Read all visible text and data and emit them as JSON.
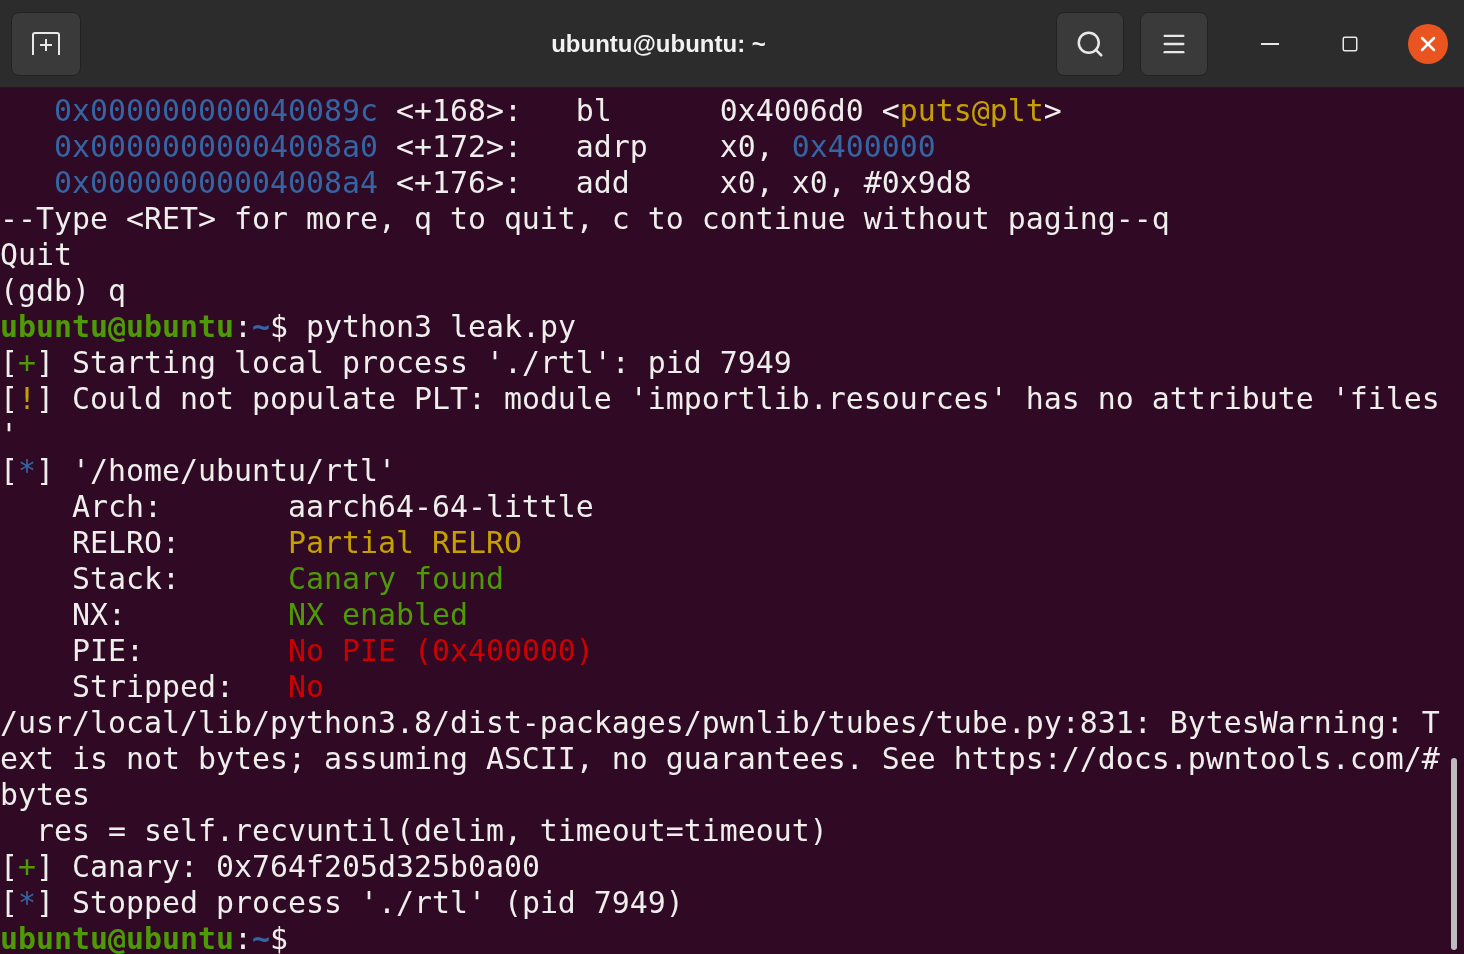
{
  "window": {
    "title": "ubuntu@ubuntu: ~"
  },
  "terminal": {
    "lines": [
      {
        "kind": "output",
        "segments": [
          {
            "text": "   0x000000000040089c",
            "color": "#3465a4"
          },
          {
            "text": " <+168>:   bl      0x4006d0 <",
            "color": "#eeeeec"
          },
          {
            "text": "puts@plt",
            "color": "#c4a000"
          },
          {
            "text": ">",
            "color": "#eeeeec"
          }
        ]
      },
      {
        "kind": "output",
        "segments": [
          {
            "text": "   0x00000000004008a0",
            "color": "#3465a4"
          },
          {
            "text": " <+172>:   adrp    x0, ",
            "color": "#eeeeec"
          },
          {
            "text": "0x400000",
            "color": "#3465a4"
          }
        ]
      },
      {
        "kind": "output",
        "segments": [
          {
            "text": "   0x00000000004008a4",
            "color": "#3465a4"
          },
          {
            "text": " <+176>:   add     x0, x0, #0x9d8",
            "color": "#eeeeec"
          }
        ]
      },
      {
        "kind": "output",
        "segments": [
          {
            "text": "--Type <RET> for more, q to quit, c to continue without paging--q",
            "color": "#eeeeec"
          }
        ]
      },
      {
        "kind": "output",
        "segments": [
          {
            "text": "Quit",
            "color": "#eeeeec"
          }
        ]
      },
      {
        "kind": "output",
        "segments": [
          {
            "text": "(gdb) q",
            "color": "#eeeeec"
          }
        ]
      },
      {
        "kind": "prompt",
        "user": "ubuntu@ubuntu",
        "separator": ":",
        "path": "~",
        "symbol": "$",
        "command": "python3 leak.py"
      },
      {
        "kind": "output",
        "segments": [
          {
            "text": "[",
            "color": "#eeeeec"
          },
          {
            "text": "+",
            "color": "#4e9a06"
          },
          {
            "text": "] Starting local process './rtl': pid 7949",
            "color": "#eeeeec"
          }
        ]
      },
      {
        "kind": "output",
        "segments": [
          {
            "text": "[",
            "color": "#eeeeec"
          },
          {
            "text": "!",
            "color": "#c4a000"
          },
          {
            "text": "] Could not populate PLT: module 'importlib.resources' has no attribute 'files",
            "color": "#eeeeec"
          }
        ]
      },
      {
        "kind": "output",
        "segments": [
          {
            "text": "'",
            "color": "#eeeeec"
          }
        ]
      },
      {
        "kind": "output",
        "segments": [
          {
            "text": "[",
            "color": "#eeeeec"
          },
          {
            "text": "*",
            "color": "#3465a4"
          },
          {
            "text": "] '/home/ubuntu/rtl'",
            "color": "#eeeeec"
          }
        ]
      },
      {
        "kind": "output",
        "segments": [
          {
            "text": "    Arch:       aarch64-64-little",
            "color": "#eeeeec"
          }
        ]
      },
      {
        "kind": "output",
        "segments": [
          {
            "text": "    RELRO:      ",
            "color": "#eeeeec"
          },
          {
            "text": "Partial RELRO",
            "color": "#c4a000"
          }
        ]
      },
      {
        "kind": "output",
        "segments": [
          {
            "text": "    Stack:      ",
            "color": "#eeeeec"
          },
          {
            "text": "Canary found",
            "color": "#4e9a06"
          }
        ]
      },
      {
        "kind": "output",
        "segments": [
          {
            "text": "    NX:         ",
            "color": "#eeeeec"
          },
          {
            "text": "NX enabled",
            "color": "#4e9a06"
          }
        ]
      },
      {
        "kind": "output",
        "segments": [
          {
            "text": "    PIE:        ",
            "color": "#eeeeec"
          },
          {
            "text": "No PIE (0x400000)",
            "color": "#cc0000"
          }
        ]
      },
      {
        "kind": "output",
        "segments": [
          {
            "text": "    Stripped:   ",
            "color": "#eeeeec"
          },
          {
            "text": "No",
            "color": "#cc0000"
          }
        ]
      },
      {
        "kind": "output",
        "segments": [
          {
            "text": "/usr/local/lib/python3.8/dist-packages/pwnlib/tubes/tube.py:831: BytesWarning: T",
            "color": "#eeeeec"
          }
        ]
      },
      {
        "kind": "output",
        "segments": [
          {
            "text": "ext is not bytes; assuming ASCII, no guarantees. See https://docs.pwntools.com/#",
            "color": "#eeeeec"
          }
        ]
      },
      {
        "kind": "output",
        "segments": [
          {
            "text": "bytes",
            "color": "#eeeeec"
          }
        ]
      },
      {
        "kind": "output",
        "segments": [
          {
            "text": "  res = self.recvuntil(delim, timeout=timeout)",
            "color": "#eeeeec"
          }
        ]
      },
      {
        "kind": "output",
        "segments": [
          {
            "text": "[",
            "color": "#eeeeec"
          },
          {
            "text": "+",
            "color": "#4e9a06"
          },
          {
            "text": "] Canary: 0x764f205d325b0a00",
            "color": "#eeeeec"
          }
        ]
      },
      {
        "kind": "output",
        "segments": [
          {
            "text": "[",
            "color": "#eeeeec"
          },
          {
            "text": "*",
            "color": "#3465a4"
          },
          {
            "text": "] Stopped process './rtl' (pid 7949)",
            "color": "#eeeeec"
          }
        ]
      },
      {
        "kind": "prompt",
        "user": "ubuntu@ubuntu",
        "separator": ":",
        "path": "~",
        "symbol": "$"
      }
    ]
  }
}
